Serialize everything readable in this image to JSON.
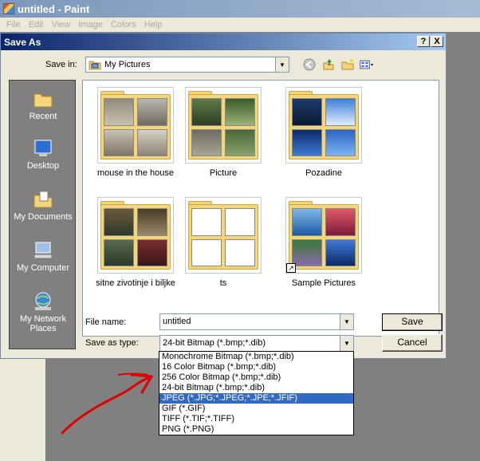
{
  "paint": {
    "title": "untitled - Paint",
    "menu": [
      "File",
      "Edit",
      "View",
      "Image",
      "Colors",
      "Help"
    ]
  },
  "dialog": {
    "title": "Save As",
    "help_btn": "?",
    "close_btn": "X",
    "save_in_label": "Save in:",
    "save_in_value": "My Pictures"
  },
  "places": [
    {
      "label": "Recent",
      "icon": "recent-icon"
    },
    {
      "label": "Desktop",
      "icon": "desktop-icon"
    },
    {
      "label": "My Documents",
      "icon": "my-documents-icon"
    },
    {
      "label": "My Computer",
      "icon": "my-computer-icon"
    },
    {
      "label": "My Network Places",
      "icon": "my-network-places-icon"
    }
  ],
  "files": [
    {
      "name": "mouse in the house"
    },
    {
      "name": "Picture"
    },
    {
      "name": "Pozadine"
    },
    {
      "name": "sitne zivotinje i biljke"
    },
    {
      "name": "ts"
    },
    {
      "name": "Sample Pictures"
    }
  ],
  "form": {
    "file_name_label": "File name:",
    "file_name_value": "untitled",
    "save_as_type_label": "Save as type:",
    "save_as_type_value": "24-bit Bitmap (*.bmp;*.dib)",
    "save_button": "Save",
    "cancel_button": "Cancel"
  },
  "file_types": [
    "Monochrome Bitmap (*.bmp;*.dib)",
    "16 Color Bitmap (*.bmp;*.dib)",
    "256 Color Bitmap (*.bmp;*.dib)",
    "24-bit Bitmap (*.bmp;*.dib)",
    "JPEG (*.JPG;*.JPEG;*.JPE;*.JFIF)",
    "GIF (*.GIF)",
    "TIFF (*.TIF;*.TIFF)",
    "PNG (*.PNG)"
  ],
  "selected_file_type": "JPEG (*.JPG;*.JPEG;*.JPE;*.JFIF)",
  "colors": {
    "selection": "#316ac5",
    "annotation_arrow": "#e00000"
  }
}
